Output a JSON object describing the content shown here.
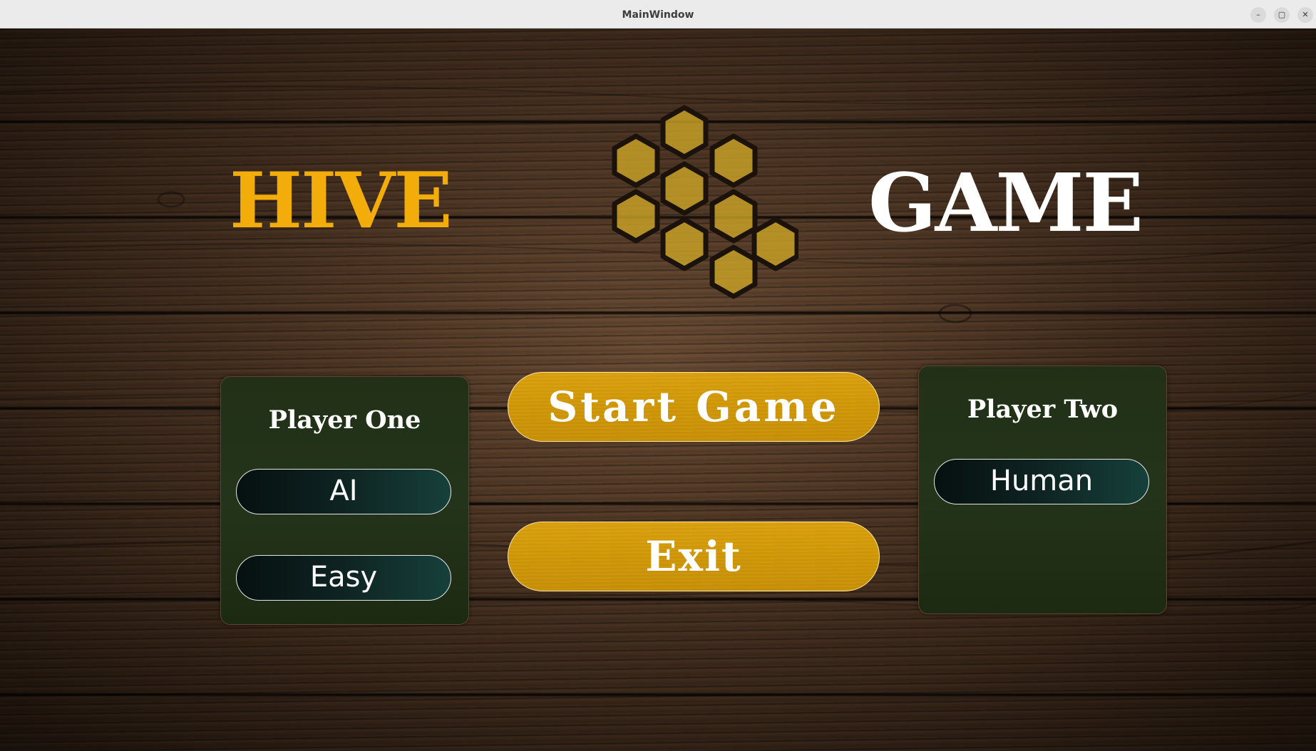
{
  "window": {
    "title": "MainWindow",
    "controls": {
      "minimize": "–",
      "maximize": "▢",
      "close": "✕"
    }
  },
  "header": {
    "title_left": "HIVE",
    "title_right": "GAME",
    "logo_icon": "honeycomb-icon"
  },
  "player_one": {
    "title": "Player One",
    "type": "AI",
    "difficulty": "Easy"
  },
  "player_two": {
    "title": "Player Two",
    "type": "Human"
  },
  "actions": {
    "start_label": "Start Game",
    "exit_label": "Exit"
  },
  "colors": {
    "accent": "#f2ad0a",
    "button": "#d79d0a",
    "panel": "#213016",
    "honeycomb": "#c9a227"
  }
}
